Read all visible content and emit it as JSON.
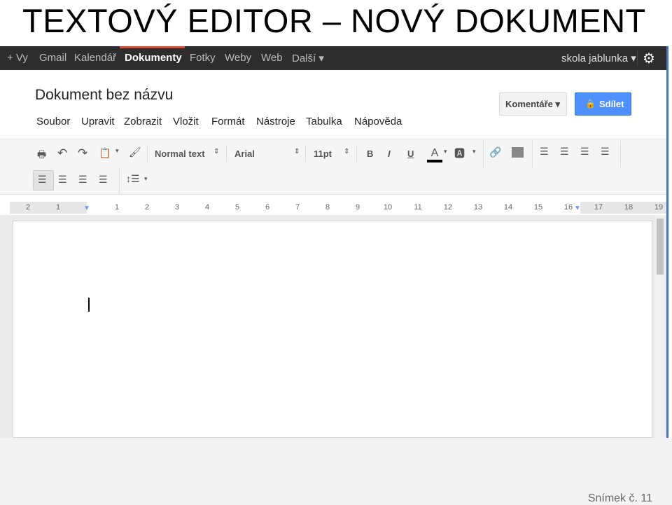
{
  "slide": {
    "title": "TEXTOVÝ EDITOR – NOVÝ DOKUMENT",
    "number": "Snímek č. 11"
  },
  "gbar": {
    "items": [
      "+ Vy",
      "Gmail",
      "Kalendář",
      "Dokumenty",
      "Fotky",
      "Weby",
      "Web",
      "Další ▾"
    ],
    "active": "Dokumenty",
    "account": "skola jablunka ▾",
    "gear_icon": "gear-icon"
  },
  "doc": {
    "title": "Dokument bez názvu",
    "menu": [
      "Soubor",
      "Upravit",
      "Zobrazit",
      "Vložit",
      "Formát",
      "Nástroje",
      "Tabulka",
      "Nápověda"
    ],
    "comments": "Komentáře ▾",
    "share": "Sdílet"
  },
  "toolbar": {
    "style": "Normal text",
    "font": "Arial",
    "size": "11pt",
    "bold": "B",
    "italic": "I",
    "underline": "U",
    "textcolor": "A",
    "textcolor_value": "#000000"
  },
  "ruler": [
    "2",
    "1",
    "1",
    "2",
    "3",
    "4",
    "5",
    "6",
    "7",
    "8",
    "9",
    "10",
    "11",
    "12",
    "13",
    "14",
    "15",
    "16",
    "17",
    "18",
    "19"
  ],
  "colors": {
    "share": "#4d90fe",
    "gbar": "#2d2d2d",
    "active_tab": "#dd4b39"
  }
}
